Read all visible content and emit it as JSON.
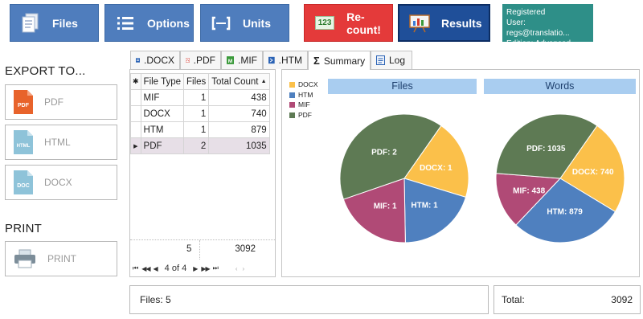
{
  "toolbar": {
    "files": "Files",
    "options": "Options",
    "units": "Units",
    "recount": "Re-count!",
    "recount_badge": "123",
    "results": "Results"
  },
  "registration": {
    "line1": "Registered",
    "line2": "User: regs@translatio...",
    "line3": "Edition: Advanced"
  },
  "sidebar": {
    "export_title": "EXPORT TO...",
    "export_buttons": [
      {
        "label": "PDF",
        "icon_text": "PDF",
        "color": "#e8632b"
      },
      {
        "label": "HTML",
        "icon_text": "HTML",
        "color": "#8ec3d9"
      },
      {
        "label": "DOCX",
        "icon_text": "DOC",
        "color": "#8ec3d9"
      }
    ],
    "print_title": "PRINT",
    "print_button": "PRINT"
  },
  "tabs": [
    {
      "label": ".DOCX",
      "icon": "docx-file-icon",
      "color": "#2b63b5"
    },
    {
      "label": ".PDF",
      "icon": "pdf-file-icon",
      "color": "#d43a2f"
    },
    {
      "label": ".MIF",
      "icon": "mif-file-icon",
      "color": "#3b9a3b"
    },
    {
      "label": ".HTM",
      "icon": "htm-file-icon",
      "color": "#2b63b5"
    },
    {
      "label": "Summary",
      "icon": "sigma-icon",
      "color": "#222222"
    },
    {
      "label": "Log",
      "icon": "log-icon",
      "color": "#2b63b5"
    }
  ],
  "active_tab": "Summary",
  "grid": {
    "columns": [
      "File Type",
      "Files",
      "Total Count"
    ],
    "rows": [
      {
        "type": "MIF",
        "files": "1",
        "count": "438"
      },
      {
        "type": "DOCX",
        "files": "1",
        "count": "740"
      },
      {
        "type": "HTM",
        "files": "1",
        "count": "879"
      },
      {
        "type": "PDF",
        "files": "2",
        "count": "1035"
      }
    ],
    "totals": {
      "files": "5",
      "count": "3092"
    },
    "pager": "4 of 4"
  },
  "chart_data": [
    {
      "type": "pie",
      "title": "Files",
      "categories": [
        "DOCX",
        "HTM",
        "MIF",
        "PDF"
      ],
      "values": [
        1,
        1,
        1,
        2
      ],
      "colors": [
        "#fbc04a",
        "#4f80bf",
        "#b04a76",
        "#5e7a54"
      ],
      "legend": "top-left"
    },
    {
      "type": "pie",
      "title": "Words",
      "categories": [
        "DOCX",
        "HTM",
        "MIF",
        "PDF"
      ],
      "values": [
        740,
        879,
        438,
        1035
      ],
      "colors": [
        "#fbc04a",
        "#4f80bf",
        "#b04a76",
        "#5e7a54"
      ],
      "legend": "top-left"
    }
  ],
  "footer": {
    "files_label": "Files: 5",
    "total_label": "Total:",
    "total_value": "3092"
  }
}
